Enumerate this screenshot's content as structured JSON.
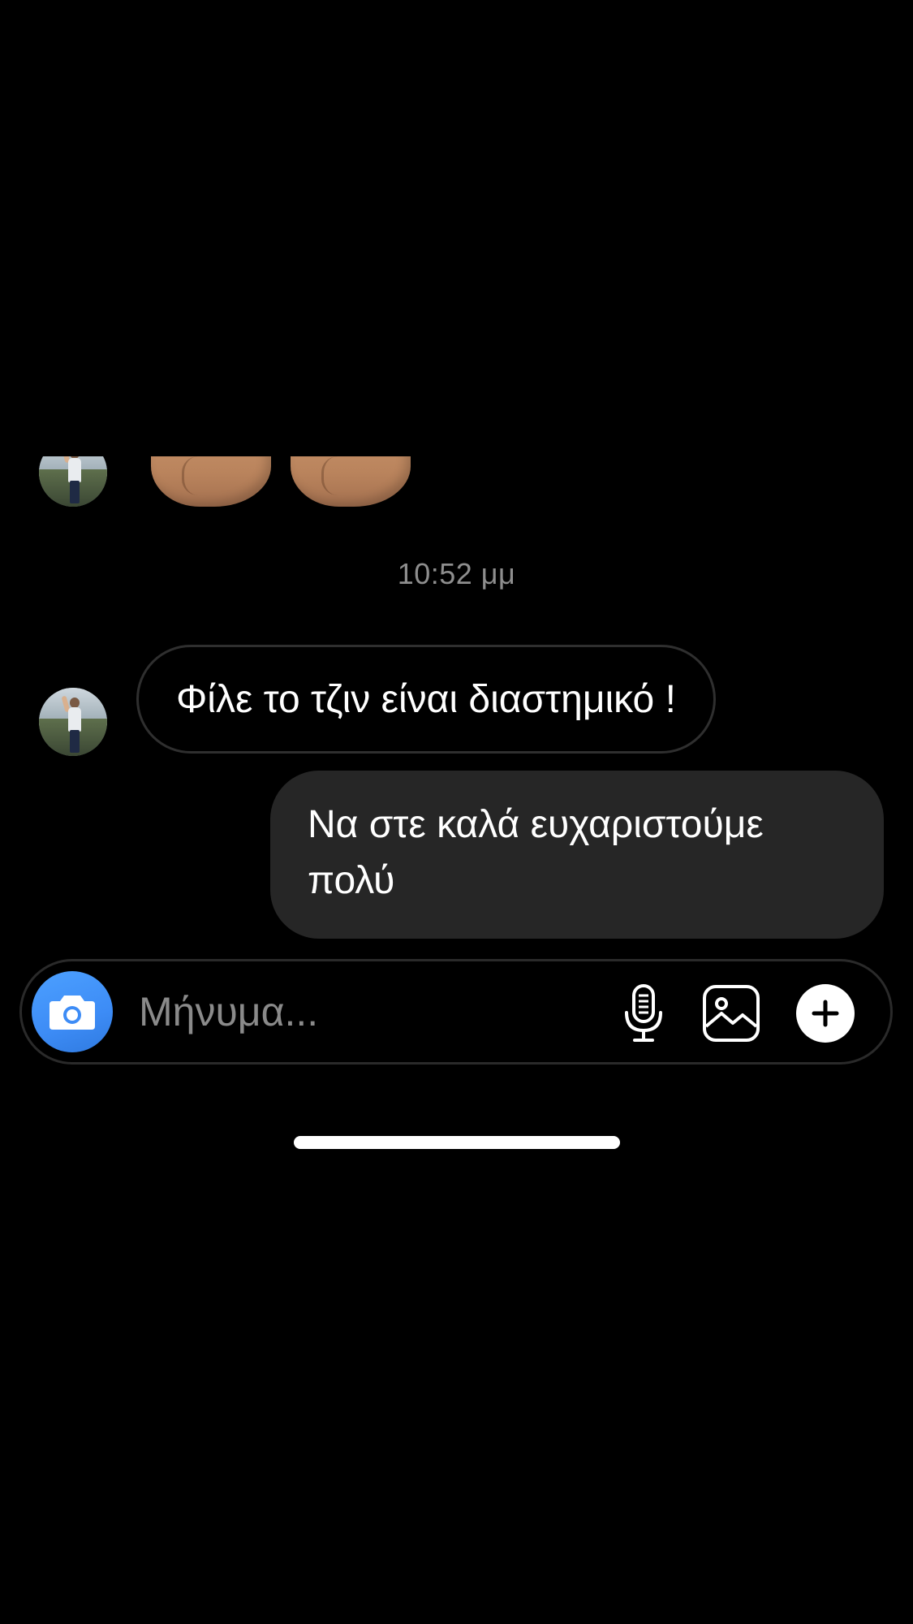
{
  "messages": {
    "timestamp": "10:52 μμ",
    "incoming": {
      "text": "Φίλε το τζιν είναι διαστημικό !"
    },
    "outgoing": {
      "text": "Να στε καλά ευχαριστούμε πολύ"
    },
    "clipped_previous": {
      "emoji": [
        "flexed-biceps-icon",
        "flexed-biceps-icon"
      ]
    }
  },
  "composer": {
    "placeholder": "Μήνυμα...",
    "camera_icon": "camera-icon",
    "mic_icon": "microphone-icon",
    "gallery_icon": "gallery-icon",
    "plus_icon": "plus-icon",
    "camera_color": "#3d8cf6"
  },
  "colors": {
    "background": "#000000",
    "outgoing_bubble": "#262626",
    "incoming_border": "#2f2f2f",
    "timestamp": "#8e8e8e"
  }
}
